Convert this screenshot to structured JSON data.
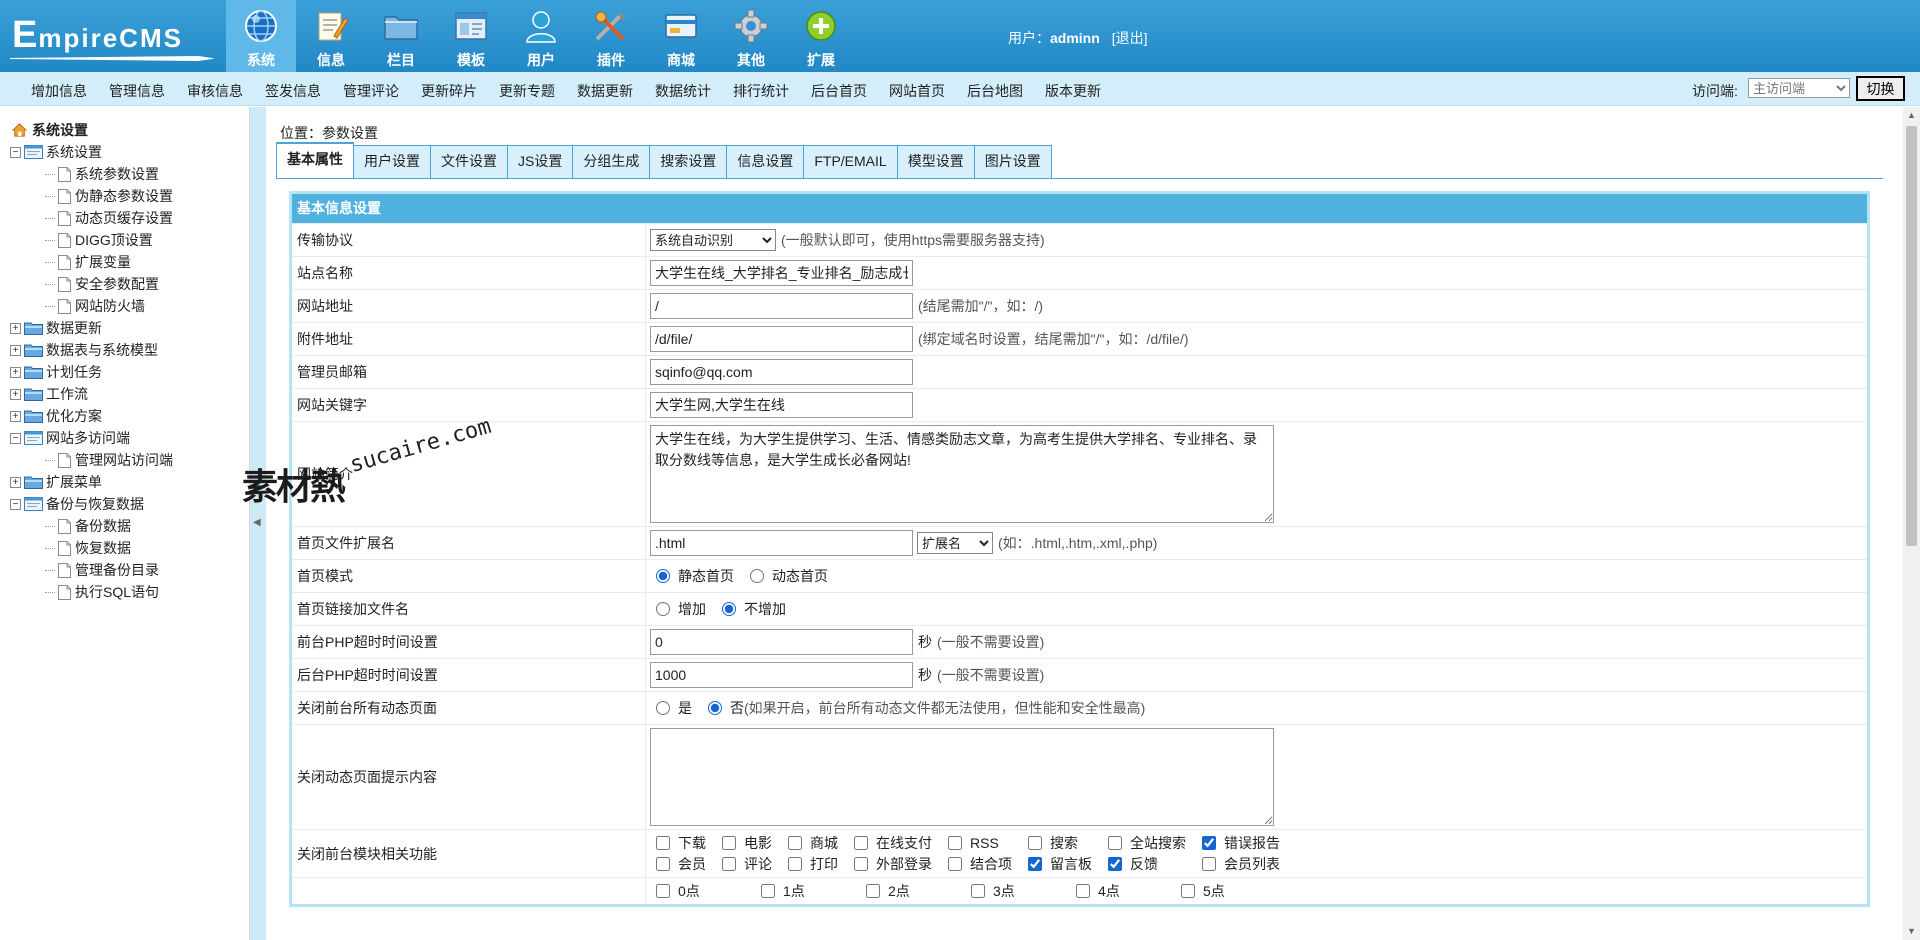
{
  "header": {
    "logo_main": "E",
    "logo_rest": "mpireCMS",
    "nav": [
      {
        "label": "系统",
        "icon": "globe-icon",
        "active": true
      },
      {
        "label": "信息",
        "icon": "edit-note-icon",
        "active": false
      },
      {
        "label": "栏目",
        "icon": "folder-icon",
        "active": false
      },
      {
        "label": "模板",
        "icon": "window-template-icon",
        "active": false
      },
      {
        "label": "用户",
        "icon": "user-icon",
        "active": false
      },
      {
        "label": "插件",
        "icon": "tools-icon",
        "active": false
      },
      {
        "label": "商城",
        "icon": "card-icon",
        "active": false
      },
      {
        "label": "其他",
        "icon": "gear-icon",
        "active": false
      },
      {
        "label": "扩展",
        "icon": "plus-circle-icon",
        "active": false
      }
    ],
    "user_label": "用户：",
    "username": "adminn",
    "logout": "[退出]"
  },
  "subnav": {
    "links": [
      "增加信息",
      "管理信息",
      "审核信息",
      "签发信息",
      "管理评论",
      "更新碎片",
      "更新专题",
      "数据更新",
      "数据统计",
      "排行统计",
      "后台首页",
      "网站首页",
      "后台地图",
      "版本更新"
    ],
    "visitor_label": "访问端:",
    "visitor_selected": "主访问端",
    "switch_button": "切换"
  },
  "sidebar": {
    "root": "系统设置",
    "groups": [
      {
        "label": "系统设置",
        "expanded": true,
        "open_folder": true,
        "children": [
          "系统参数设置",
          "伪静态参数设置",
          "动态页缓存设置",
          "DIGG顶设置",
          "扩展变量",
          "安全参数配置",
          "网站防火墙"
        ]
      },
      {
        "label": "数据更新",
        "expanded": false,
        "children": []
      },
      {
        "label": "数据表与系统模型",
        "expanded": false,
        "children": []
      },
      {
        "label": "计划任务",
        "expanded": false,
        "children": []
      },
      {
        "label": "工作流",
        "expanded": false,
        "children": []
      },
      {
        "label": "优化方案",
        "expanded": false,
        "children": []
      },
      {
        "label": "网站多访问端",
        "expanded": true,
        "open_folder": true,
        "children": [
          "管理网站访问端"
        ]
      },
      {
        "label": "扩展菜单",
        "expanded": false,
        "children": []
      },
      {
        "label": "备份与恢复数据",
        "expanded": true,
        "open_folder": true,
        "children": [
          "备份数据",
          "恢复数据",
          "管理备份目录",
          "执行SQL语句"
        ]
      }
    ]
  },
  "content": {
    "location": "位置：参数设置",
    "tabs": [
      "基本属性",
      "用户设置",
      "文件设置",
      "JS设置",
      "分组生成",
      "搜索设置",
      "信息设置",
      "FTP/EMAIL",
      "模型设置",
      "图片设置"
    ],
    "active_tab": 0,
    "panel_title": "基本信息设置",
    "fields": {
      "protocol": {
        "label": "传输协议",
        "selected": "系统自动识别",
        "note": "(一般默认即可，使用https需要服务器支持)"
      },
      "site_name": {
        "label": "站点名称",
        "value": "大学生在线_大学排名_专业排名_励志成长_赢在起点"
      },
      "site_url": {
        "label": "网站地址",
        "value": "/",
        "note": "(结尾需加\"/\"，如：/)"
      },
      "attach_url": {
        "label": "附件地址",
        "value": "/d/file/",
        "note": "(绑定域名时设置，结尾需加\"/\"，如：/d/file/)"
      },
      "admin_email": {
        "label": "管理员邮箱",
        "value": "sqinfo@qq.com"
      },
      "keywords": {
        "label": "网站关键字",
        "value": "大学生网,大学生在线"
      },
      "description": {
        "label": "网站简介",
        "value": "大学生在线，为大学生提供学习、生活、情感类励志文章，为高考生提供大学排名、专业排名、录取分数线等信息，是大学生成长必备网站!"
      },
      "index_ext": {
        "label": "首页文件扩展名",
        "value": ".html",
        "select": "扩展名",
        "note": "(如：.html,.htm,.xml,.php)"
      },
      "index_mode": {
        "label": "首页模式",
        "options": [
          "静态首页",
          "动态首页"
        ],
        "selected": 0
      },
      "index_link": {
        "label": "首页链接加文件名",
        "options": [
          "增加",
          "不增加"
        ],
        "selected": 1
      },
      "front_timeout": {
        "label": "前台PHP超时时间设置",
        "value": "0",
        "unit": "秒",
        "note": "(一般不需要设置)"
      },
      "back_timeout": {
        "label": "后台PHP超时时间设置",
        "value": "1000",
        "unit": "秒",
        "note": "(一般不需要设置)"
      },
      "close_dynamic": {
        "label": "关闭前台所有动态页面",
        "options": [
          "是",
          "否"
        ],
        "selected": 1,
        "note": "(如果开启，前台所有动态文件都无法使用，但性能和安全性最高)"
      },
      "close_tip": {
        "label": "关闭动态页面提示内容",
        "value": ""
      },
      "close_modules": {
        "label": "关闭前台模块相关功能",
        "items": [
          {
            "label": "下载",
            "checked": false
          },
          {
            "label": "电影",
            "checked": false
          },
          {
            "label": "商城",
            "checked": false
          },
          {
            "label": "在线支付",
            "checked": false
          },
          {
            "label": "RSS",
            "checked": false
          },
          {
            "label": "搜索",
            "checked": false
          },
          {
            "label": "全站搜索",
            "checked": false
          },
          {
            "label": "错误报告",
            "checked": true
          },
          {
            "label": "会员",
            "checked": false
          },
          {
            "label": "评论",
            "checked": false
          },
          {
            "label": "打印",
            "checked": false
          },
          {
            "label": "外部登录",
            "checked": false
          },
          {
            "label": "结合项",
            "checked": false
          },
          {
            "label": "留言板",
            "checked": true
          },
          {
            "label": "反馈",
            "checked": true
          },
          {
            "label": "会员列表",
            "checked": false
          }
        ]
      },
      "hours": [
        "0点",
        "1点",
        "2点",
        "3点",
        "4点",
        "5点"
      ]
    }
  },
  "watermark": {
    "cn": "素材熱",
    "en": "sucaire.com"
  },
  "colors": {
    "header_bg": "#2a8fcb",
    "subnav_bg": "#d3eefa",
    "panel_title_bg": "#4eb1de",
    "tab_border": "#4aa5d5"
  }
}
